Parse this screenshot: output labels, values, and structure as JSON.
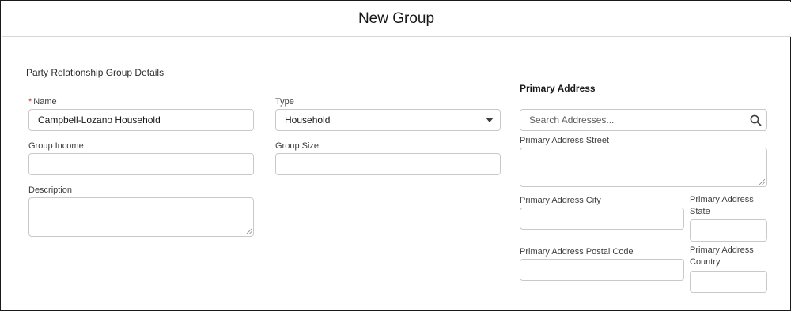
{
  "modal": {
    "title": "New Group"
  },
  "section": {
    "title": "Party Relationship Group Details"
  },
  "fields": {
    "name": {
      "required_marker": "*",
      "label": "Name",
      "value": "Campbell-Lozano Household"
    },
    "type": {
      "label": "Type",
      "value": "Household"
    },
    "group_income": {
      "label": "Group Income",
      "value": ""
    },
    "group_size": {
      "label": "Group Size",
      "value": ""
    },
    "description": {
      "label": "Description",
      "value": ""
    }
  },
  "address": {
    "heading": "Primary Address",
    "search_placeholder": "Search Addresses...",
    "street": {
      "label": "Primary Address Street"
    },
    "city": {
      "label": "Primary Address City"
    },
    "state": {
      "label_line1": "Primary Address",
      "label_line2": "State"
    },
    "postal": {
      "label": "Primary Address Postal Code"
    },
    "country": {
      "label_line1": "Primary Address",
      "label_line2": "Country"
    }
  },
  "colors": {
    "required": "#c23934",
    "border": "#c9c9c9",
    "text": "#181818"
  },
  "icons": {
    "search": "search-icon",
    "dropdown": "chevron-down-icon",
    "resize": "resize-handle-icon"
  }
}
